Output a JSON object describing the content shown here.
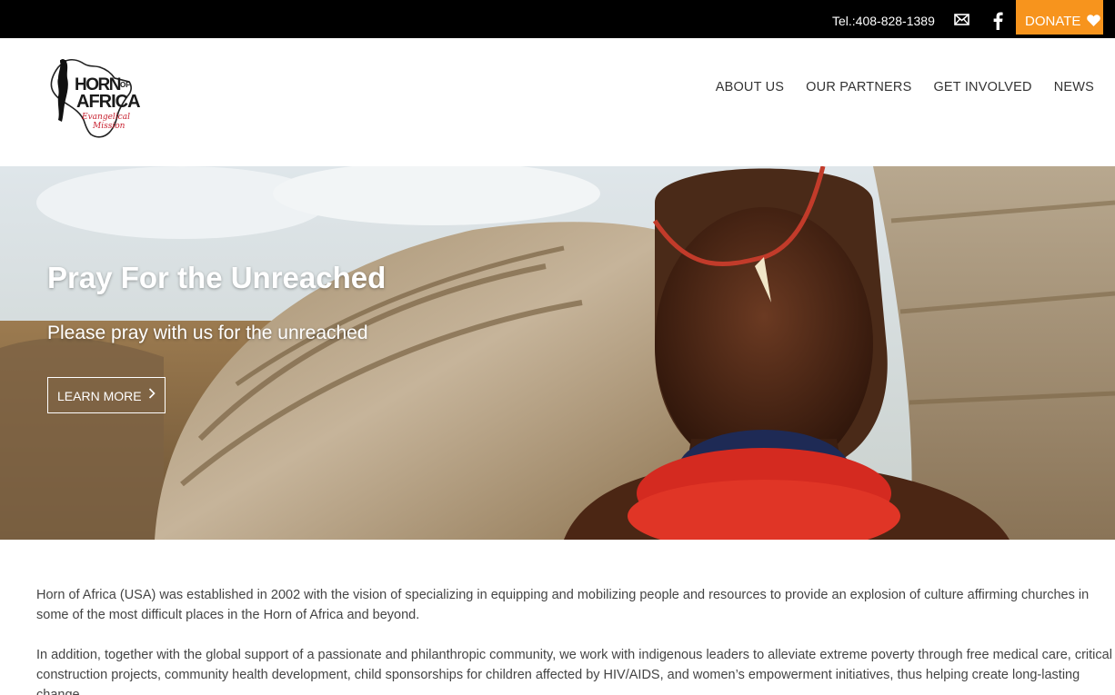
{
  "topbar": {
    "phone": "Tel.:408-828-1389",
    "mail_icon": "envelope-icon",
    "facebook_icon": "facebook-icon",
    "donate_label": "DONATE",
    "donate_icon": "heart-icon",
    "donate_color": "#f7941d"
  },
  "logo": {
    "line1": "HORN",
    "line1_of": "OF",
    "line2": "AFRICA",
    "line3": "Evangelical",
    "line4": "Mission"
  },
  "nav": {
    "items": [
      {
        "label": "ABOUT US"
      },
      {
        "label": "OUR PARTNERS"
      },
      {
        "label": "GET INVOLVED"
      },
      {
        "label": "NEWS"
      }
    ]
  },
  "hero": {
    "title": "Pray For the Unreached",
    "subtitle": "Please pray with us for the unreached",
    "button_label": "LEARN MORE",
    "button_icon": "chevron-right-icon"
  },
  "content": {
    "paragraphs": [
      "Horn of Africa (USA) was established in 2002 with the vision of specializing in equipping and mobilizing people and resources to provide an explosion of culture affirming churches in some of the most difficult places in the Horn of Africa and beyond.",
      "In addition, together with the global support of a passionate and philanthropic community, we work with indigenous leaders to alleviate extreme poverty through free medical care, critical construction projects, community health development, child sponsorships for children affected by HIV/AIDS, and women’s empowerment initiatives, thus helping create long-lasting change."
    ]
  }
}
